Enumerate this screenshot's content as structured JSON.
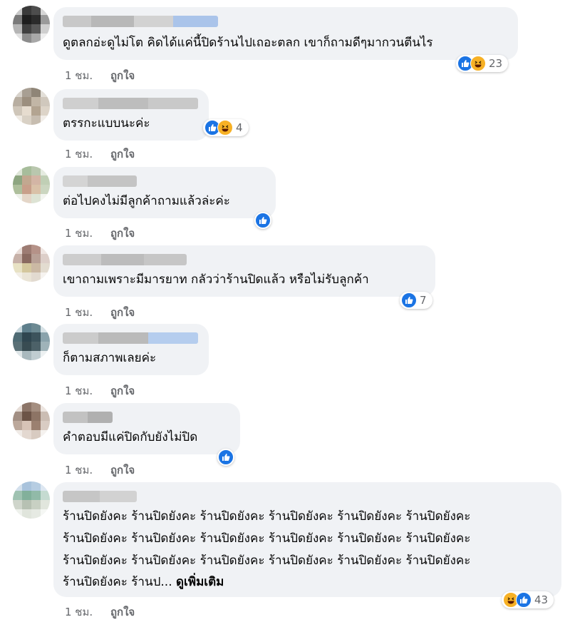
{
  "comments": [
    {
      "text": [
        "ดูตลกอ่ะดูไม่โต คิดได้แค่นี้ปิดร้านไปเถอะตลก เขาก็ถามดีๆมากวนตีนไร"
      ],
      "time": "1 ชม.",
      "like_label": "ถูกใจ",
      "reactions": [
        "like-icon",
        "haha-icon"
      ],
      "count": "23"
    },
    {
      "text": [
        "ตรรกะแบบนะค่ะ"
      ],
      "time": "1 ชม.",
      "like_label": "ถูกใจ",
      "reactions": [
        "like-icon",
        "haha-icon"
      ],
      "count": "4"
    },
    {
      "text": [
        "ต่อไปคงไม่มีลูกค้าถามแล้วล่ะค่ะ"
      ],
      "time": "1 ชม.",
      "like_label": "ถูกใจ",
      "reactions": [
        "like-icon"
      ],
      "count": ""
    },
    {
      "text": [
        "เขาถามเพราะมีมารยาท กลัวว่าร้านปิดแล้ว หรือไม่รับลูกค้า"
      ],
      "time": "1 ชม.",
      "like_label": "ถูกใจ",
      "reactions": [
        "like-icon"
      ],
      "count": "7"
    },
    {
      "text": [
        "ก็ตามสภาพเลยค่ะ"
      ],
      "time": "1 ชม.",
      "like_label": "ถูกใจ",
      "reactions": [],
      "count": ""
    },
    {
      "text": [
        "คำตอบมีแค่ปิดกับยังไม่ปิด"
      ],
      "time": "1 ชม.",
      "like_label": "ถูกใจ",
      "reactions": [
        "like-icon"
      ],
      "count": ""
    },
    {
      "text": [
        "ร้านปิดยังคะ ร้านปิดยังคะ ร้านปิดยังคะ ร้านปิดยังคะ ร้านปิดยังคะ ร้านปิดยังคะ",
        "ร้านปิดยังคะ ร้านปิดยังคะ ร้านปิดยังคะ ร้านปิดยังคะ ร้านปิดยังคะ ร้านปิดยังคะ",
        "ร้านปิดยังคะ ร้านปิดยังคะ ร้านปิดยังคะ ร้านปิดยังคะ ร้านปิดยังคะ ร้านปิดยังคะ",
        "ร้านปิดยังคะ ร้านป..."
      ],
      "see_more": "ดูเพิ่มเติม",
      "time": "1 ชม.",
      "like_label": "ถูกใจ",
      "reactions": [
        "haha-icon",
        "like-icon"
      ],
      "count": "43"
    }
  ],
  "colors": {
    "bubble": "#f0f2f5",
    "like_blue": "#1b74e4",
    "haha_yellow": "#f7b125",
    "meta_gray": "#65676b"
  }
}
